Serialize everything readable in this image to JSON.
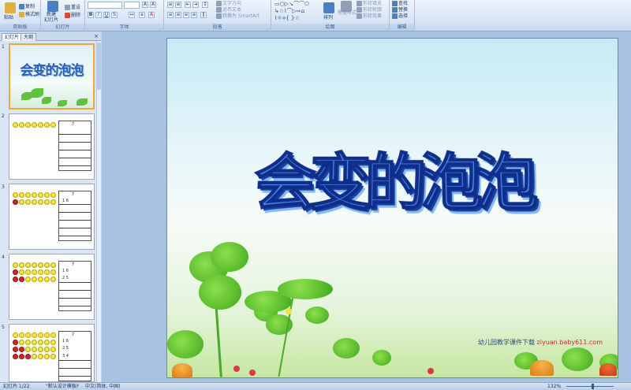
{
  "ribbon": {
    "clipboard": {
      "label": "剪贴板",
      "paste": "粘贴",
      "copy": "复制",
      "format_painter": "格式刷"
    },
    "slides": {
      "label": "幻灯片",
      "new_slide": "新建",
      "new_slide_2": "幻灯片",
      "reset": "重设",
      "delete": "删除"
    },
    "font": {
      "label": "字体"
    },
    "paragraph": {
      "label": "段落",
      "text_direction": "文字方向",
      "align_text": "对齐文本",
      "smartart": "转换为 SmartArt"
    },
    "drawing": {
      "label": "绘图",
      "arrange": "排列",
      "quick_styles": "快速样式",
      "shape_fill": "形状填充",
      "shape_outline": "形状轮廓",
      "shape_effects": "形状效果"
    },
    "editing": {
      "label": "编辑",
      "find": "查找",
      "replace": "替换",
      "select": "选择"
    }
  },
  "panel": {
    "tabs": [
      "幻灯片",
      "大纲"
    ],
    "close": "×",
    "slides": [
      {
        "num": "1",
        "title": "会变的泡泡"
      },
      {
        "num": "2",
        "top": "7",
        "rows": [
          "",
          "",
          "",
          "",
          "",
          ""
        ]
      },
      {
        "num": "3",
        "top": "7",
        "rows": [
          "1 6",
          "",
          "",
          "",
          "",
          ""
        ]
      },
      {
        "num": "4",
        "top": "7",
        "rows": [
          "1 6",
          "2 5",
          "",
          "",
          "",
          ""
        ]
      },
      {
        "num": "5",
        "top": "7",
        "rows": [
          "1 6",
          "2 5",
          "3 4",
          "",
          "",
          ""
        ]
      }
    ]
  },
  "slide": {
    "title": "会变的泡泡",
    "credit": "幼儿园教学课件下载",
    "credit_url": "ziyuan.baby611.com"
  },
  "status": {
    "slide_count": "幻灯片 1/22",
    "theme": "\"默认设计模板\"",
    "language": "中文(简体, 中国)",
    "zoom": "132%",
    "zoom_level": 0.55
  }
}
